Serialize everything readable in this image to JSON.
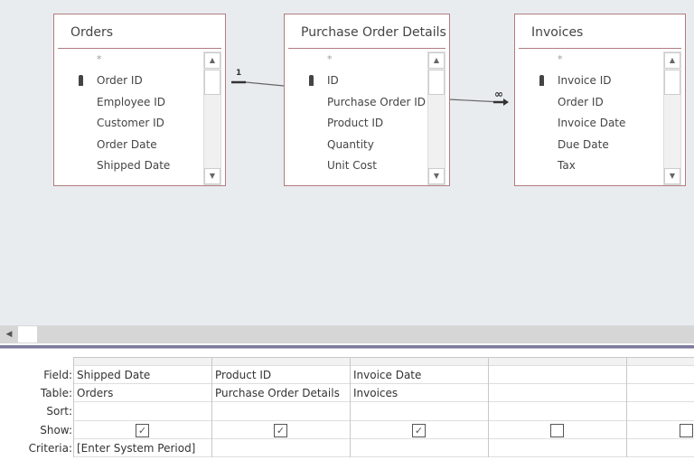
{
  "tables": [
    {
      "name": "Orders",
      "fields": [
        "*",
        "Order ID",
        "Employee ID",
        "Customer ID",
        "Order Date",
        "Shipped Date"
      ]
    },
    {
      "name": "Purchase Order Details",
      "fields": [
        "*",
        "ID",
        "Purchase Order ID",
        "Product ID",
        "Quantity",
        "Unit Cost"
      ]
    },
    {
      "name": "Invoices",
      "fields": [
        "*",
        "Invoice ID",
        "Order ID",
        "Invoice Date",
        "Due Date",
        "Tax"
      ]
    }
  ],
  "relationships": [
    {
      "one_label": "1",
      "many_label": "∞"
    }
  ],
  "grid": {
    "row_labels": [
      "Field:",
      "Table:",
      "Sort:",
      "Show:",
      "Criteria:"
    ],
    "columns": [
      {
        "field": "Shipped Date",
        "table": "Orders",
        "sort": "",
        "show": true,
        "criteria": "[Enter System Period]"
      },
      {
        "field": "Product ID",
        "table": "Purchase Order Details",
        "sort": "",
        "show": true,
        "criteria": ""
      },
      {
        "field": "Invoice Date",
        "table": "Invoices",
        "sort": "",
        "show": true,
        "criteria": ""
      },
      {
        "field": "",
        "table": "",
        "sort": "",
        "show": false,
        "criteria": ""
      },
      {
        "field": "",
        "table": "",
        "sort": "",
        "show": false,
        "criteria": ""
      }
    ]
  }
}
